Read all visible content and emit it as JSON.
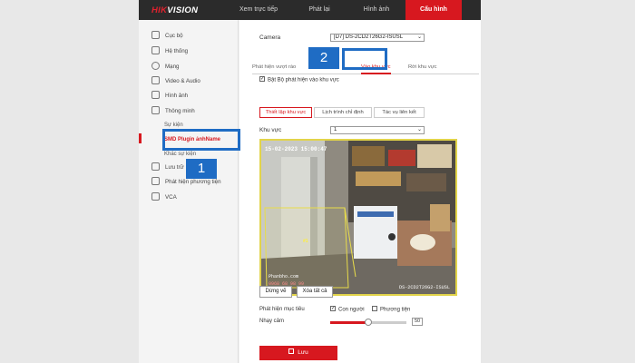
{
  "header": {
    "logo_hik": "HIK",
    "logo_vision": "VISION",
    "nav": [
      {
        "label": "Xem trực tiếp"
      },
      {
        "label": "Phát lại"
      },
      {
        "label": "Hình ảnh"
      },
      {
        "label": "Cấu hình"
      }
    ]
  },
  "sidebar": {
    "items": [
      {
        "label": "Cục bộ",
        "icon": "monitor-icon"
      },
      {
        "label": "Hệ thống",
        "icon": "system-icon"
      },
      {
        "label": "Mạng",
        "icon": "globe-icon"
      },
      {
        "label": "Video & Audio",
        "icon": "video-icon"
      },
      {
        "label": "Hình ảnh",
        "icon": "image-icon"
      },
      {
        "label": "Thông minh",
        "icon": "calendar-icon"
      }
    ],
    "subitems": [
      {
        "label": "Sự kiện"
      },
      {
        "label": "SMD Plugin ảnhName"
      },
      {
        "label": "Khác sự kiện"
      }
    ],
    "items2": [
      {
        "label": "Lưu trữ",
        "icon": "storage-icon"
      },
      {
        "label": "Phát hiện phương tiện",
        "icon": "vehicle-icon"
      },
      {
        "label": "VCA",
        "icon": "vca-icon"
      }
    ]
  },
  "main": {
    "camera_label": "Camera",
    "camera_value": "[D7] DS-2CD2T26G2-ISUSL",
    "tabs": [
      {
        "label": "Phát hiện vượt rào"
      },
      {
        "label": "Vào khu vực"
      },
      {
        "label": "Rời khu vực"
      }
    ],
    "enable_label": "Bật Bộ phát hiện vào khu vực",
    "subtabs": [
      {
        "label": "Thiết lập khu vực"
      },
      {
        "label": "Lịch trình chỉ định"
      },
      {
        "label": "Tác vụ liên kết"
      }
    ],
    "area_label": "Khu vực",
    "area_value": "1",
    "video": {
      "timestamp": "15-02-2023  15:00:47",
      "area_tag": "#1",
      "wm1": "Phanbho.com",
      "wm2": "0968 68 98 99",
      "cam_name": "DS-2CD2T26G2-ISUSL"
    },
    "draw_button": "Dừng vẽ",
    "clear_button": "Xóa tất cả",
    "target_label": "Phát hiện mục tiêu",
    "target_person": "Con người",
    "target_vehicle": "Phương tiện",
    "sensitivity_label": "Nhạy cảm",
    "sensitivity_value": "50",
    "save_label": "Lưu"
  },
  "callouts": {
    "one": "1",
    "two": "2"
  },
  "colors": {
    "accent": "#d7181f",
    "callout": "#1f6cc4",
    "zone": "#e2d44a"
  }
}
